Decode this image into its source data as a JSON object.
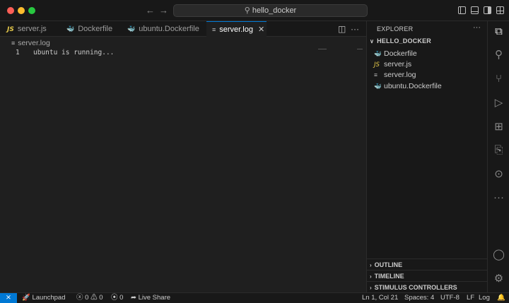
{
  "titlebar": {
    "search_text": "hello_docker",
    "nav_back_icon": "arrow-left-icon",
    "nav_forward_icon": "arrow-right-icon"
  },
  "tabs": [
    {
      "label": "server.js",
      "icon": "js-icon",
      "icon_glyph": "JS"
    },
    {
      "label": "Dockerfile",
      "icon": "docker-icon",
      "icon_glyph": "🐳"
    },
    {
      "label": "ubuntu.Dockerfile",
      "icon": "docker-icon",
      "icon_glyph": "🐳"
    },
    {
      "label": "server.log",
      "icon": "log-icon",
      "icon_glyph": "≡",
      "active": true
    }
  ],
  "editor": {
    "breadcrumb": "server.log",
    "lines": [
      {
        "number": "1",
        "text": "ubuntu is running..."
      }
    ]
  },
  "explorer": {
    "title": "EXPLORER",
    "folder": "HELLO_DOCKER",
    "files": [
      {
        "label": "Dockerfile",
        "icon": "docker-icon",
        "glyph": "🐳"
      },
      {
        "label": "server.js",
        "icon": "js-icon",
        "glyph": "JS"
      },
      {
        "label": "server.log",
        "icon": "log-icon",
        "glyph": "≡"
      },
      {
        "label": "ubuntu.Dockerfile",
        "icon": "docker-icon",
        "glyph": "🐳"
      }
    ],
    "sections": [
      "OUTLINE",
      "TIMELINE",
      "STIMULUS CONTROLLERS"
    ]
  },
  "statusbar": {
    "launchpad": "Launchpad",
    "errors": "0",
    "warnings": "0",
    "ports": "0",
    "live_share": "Live Share",
    "position": "Ln 1, Col 21",
    "spaces": "Spaces: 4",
    "encoding": "UTF-8",
    "eol": "LF",
    "language": "Log"
  },
  "colors": {
    "accent": "#0078d4",
    "js_icon": "#e6c94a",
    "docker_icon": "#4a9fe0"
  }
}
